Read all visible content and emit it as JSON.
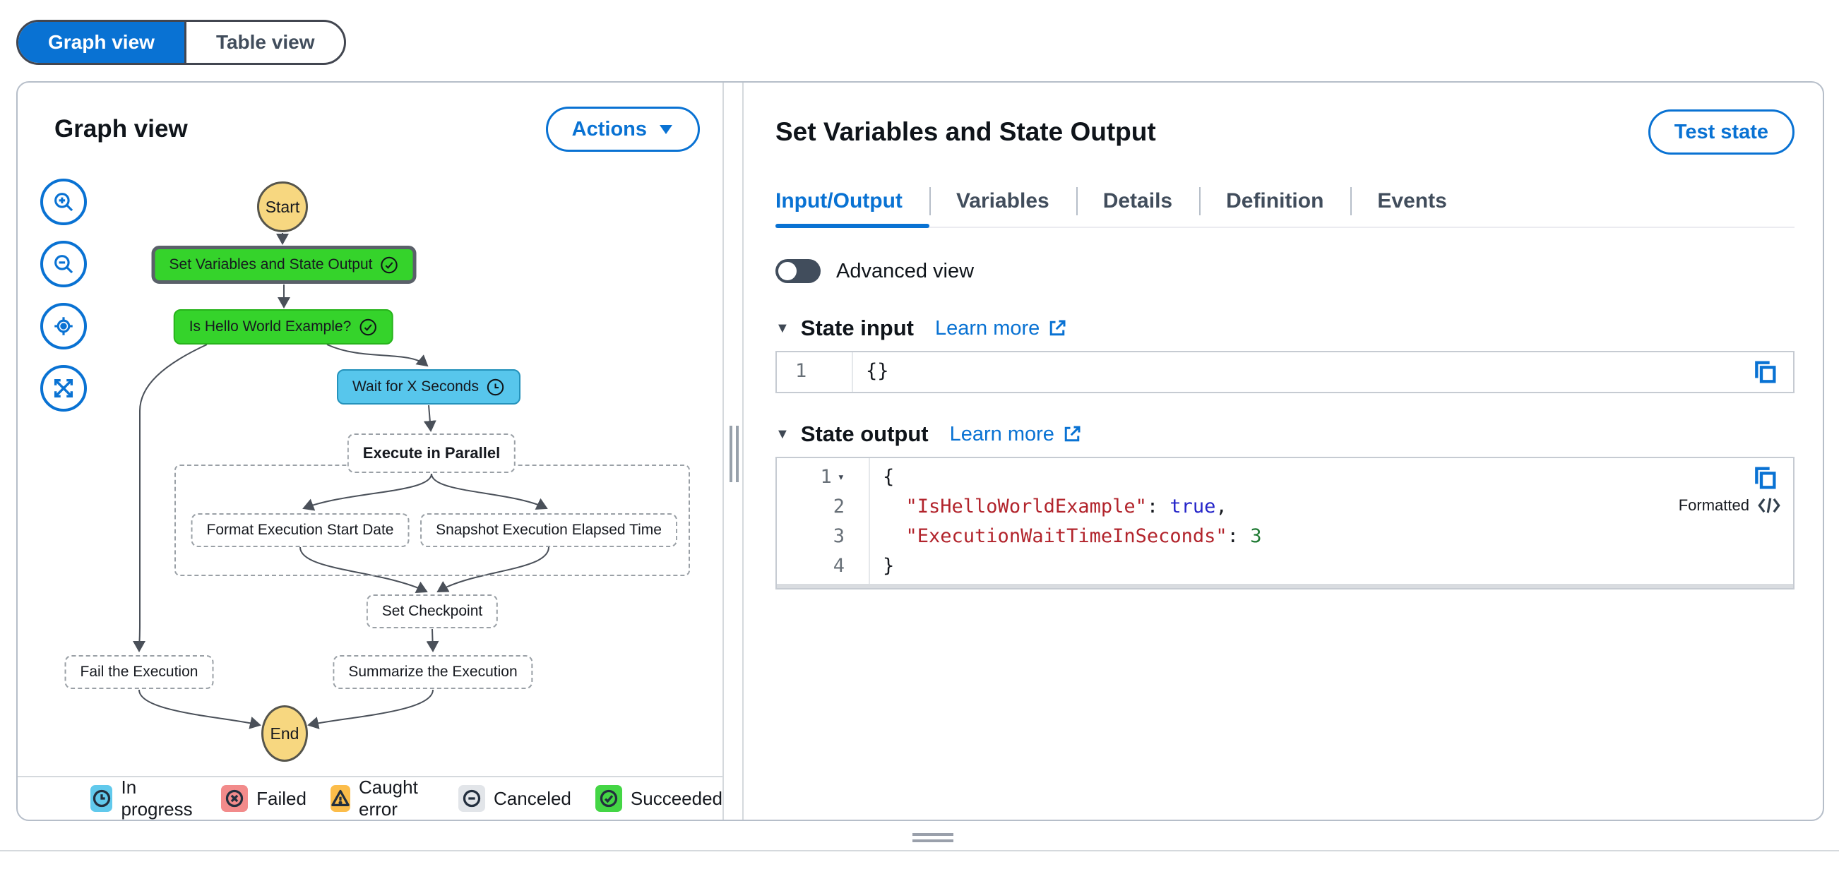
{
  "view_toggle": {
    "graph_label": "Graph view",
    "table_label": "Table view"
  },
  "graph_panel": {
    "title": "Graph view",
    "actions_label": "Actions",
    "nodes": {
      "start": "Start",
      "set_variables": "Set Variables and State Output",
      "is_hello": "Is Hello World Example?",
      "wait": "Wait for X Seconds",
      "parallel": "Execute in Parallel",
      "format_date": "Format Execution Start Date",
      "snapshot": "Snapshot Execution Elapsed Time",
      "checkpoint": "Set Checkpoint",
      "summarize": "Summarize the Execution",
      "fail": "Fail the Execution",
      "end": "End"
    },
    "legend": [
      {
        "label": "In progress",
        "color": "#61c9ec",
        "icon": "clock"
      },
      {
        "label": "Failed",
        "color": "#f28b8b",
        "icon": "x-circle"
      },
      {
        "label": "Caught error",
        "color": "#fcbd4a",
        "icon": "warning-triangle"
      },
      {
        "label": "Canceled",
        "color": "#e2e5e9",
        "icon": "minus-circle"
      },
      {
        "label": "Succeeded",
        "color": "#44d645",
        "icon": "check-circle"
      }
    ]
  },
  "details_panel": {
    "title": "Set Variables and State Output",
    "test_state_label": "Test state",
    "tabs": [
      {
        "label": "Input/Output",
        "active": true
      },
      {
        "label": "Variables",
        "active": false
      },
      {
        "label": "Details",
        "active": false
      },
      {
        "label": "Definition",
        "active": false
      },
      {
        "label": "Events",
        "active": false
      }
    ],
    "advanced_view_label": "Advanced view",
    "state_input": {
      "heading": "State input",
      "learn_more": "Learn more",
      "lines": [
        {
          "num": "1",
          "tokens": [
            {
              "t": "{}",
              "c": "plain"
            }
          ]
        }
      ]
    },
    "state_output": {
      "heading": "State output",
      "learn_more": "Learn more",
      "formatted_label": "Formatted",
      "lines": [
        {
          "num": "1",
          "fold": true,
          "tokens": [
            {
              "t": "{",
              "c": "plain"
            }
          ]
        },
        {
          "num": "2",
          "tokens": [
            {
              "t": "  ",
              "c": "plain"
            },
            {
              "t": "\"IsHelloWorldExample\"",
              "c": "key"
            },
            {
              "t": ": ",
              "c": "plain"
            },
            {
              "t": "true",
              "c": "bool"
            },
            {
              "t": ",",
              "c": "plain"
            }
          ]
        },
        {
          "num": "3",
          "tokens": [
            {
              "t": "  ",
              "c": "plain"
            },
            {
              "t": "\"ExecutionWaitTimeInSeconds\"",
              "c": "key"
            },
            {
              "t": ": ",
              "c": "plain"
            },
            {
              "t": "3",
              "c": "num"
            }
          ]
        },
        {
          "num": "4",
          "tokens": [
            {
              "t": "}",
              "c": "plain"
            }
          ]
        }
      ]
    }
  },
  "colors": {
    "accent_blue": "#0972d3",
    "succeeded_green": "#35d32b",
    "in_progress_blue": "#57c6ec",
    "terminal_yellow": "#f7d780",
    "selected_border": "#5a6069"
  }
}
